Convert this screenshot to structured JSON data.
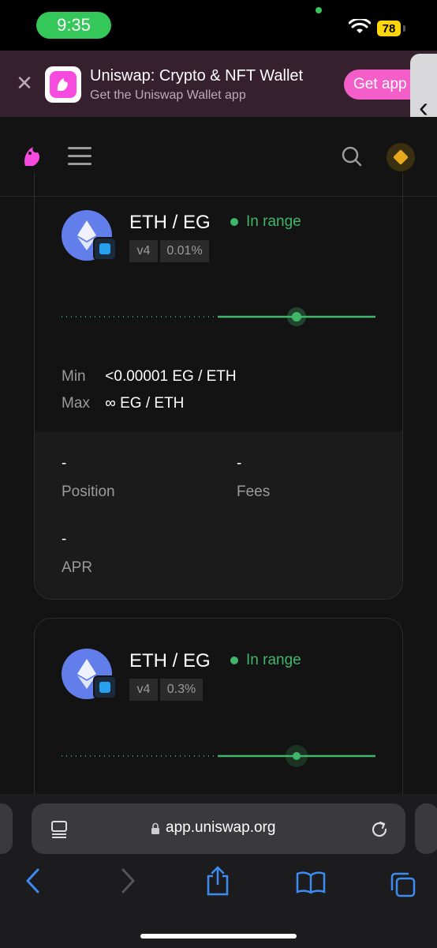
{
  "status_bar": {
    "time": "9:35",
    "battery": "78"
  },
  "banner": {
    "title": "Uniswap: Crypto & NFT Wallet",
    "subtitle": "Get the Uniswap Wallet app",
    "cta": "Get app",
    "close_icon": "close-icon"
  },
  "positions": [
    {
      "pair": "ETH / EG",
      "status": "In range",
      "version": "v4",
      "fee": "0.01%",
      "min_label": "Min",
      "min_value": "<0.00001 EG / ETH",
      "max_label": "Max",
      "max_value": "∞  EG / ETH",
      "position_value": "-",
      "position_label": "Position",
      "fees_value": "-",
      "fees_label": "Fees",
      "apr_value": "-",
      "apr_label": "APR"
    },
    {
      "pair": "ETH / EG",
      "status": "In range",
      "version": "v4",
      "fee": "0.3%"
    }
  ],
  "browser": {
    "url": "app.uniswap.org"
  },
  "colors": {
    "accent_pink": "#f45ec9",
    "in_range_green": "#40b66b",
    "eth_blue": "#627eea"
  }
}
